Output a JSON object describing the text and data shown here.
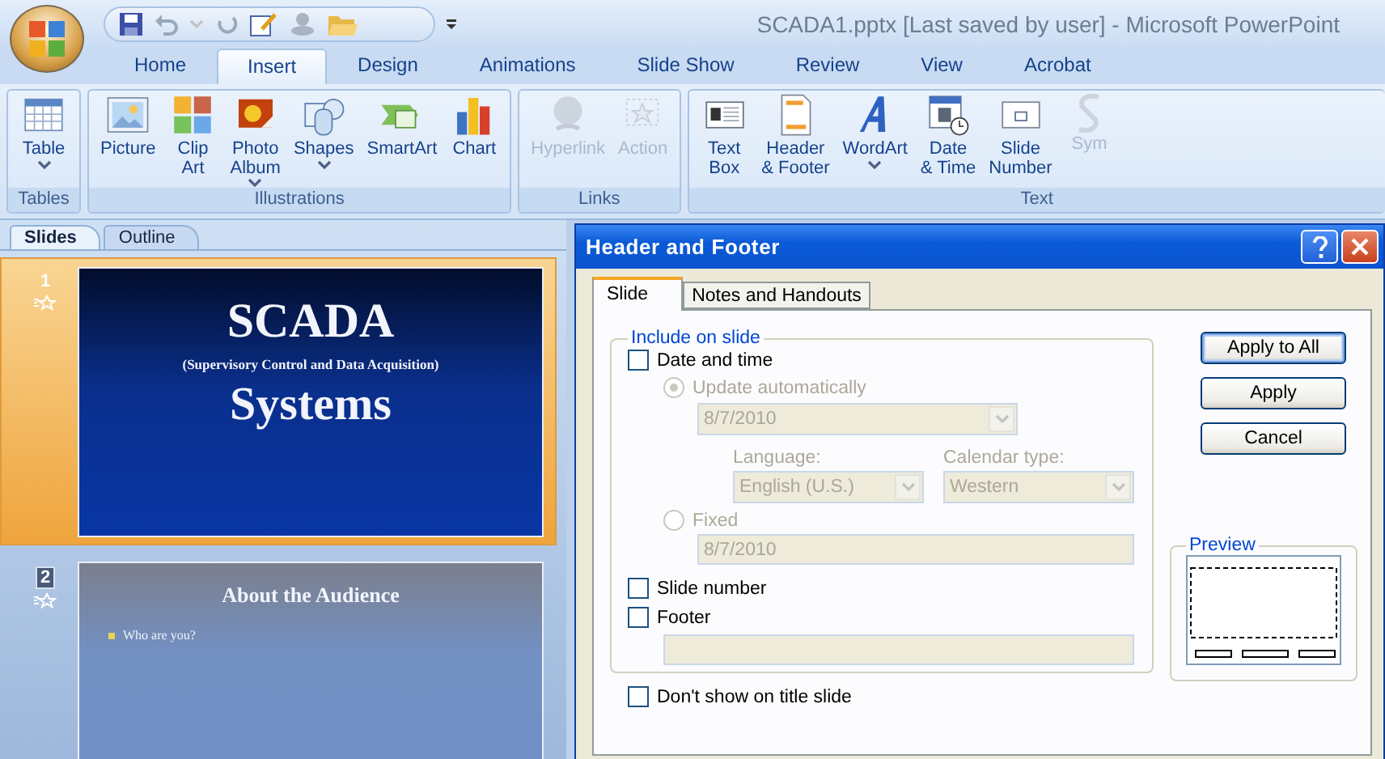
{
  "window": {
    "title": "SCADA1.pptx [Last saved by user] - Microsoft PowerPoint"
  },
  "ribbon_tabs": [
    {
      "label": "Home",
      "selected": false
    },
    {
      "label": "Insert",
      "selected": true
    },
    {
      "label": "Design",
      "selected": false
    },
    {
      "label": "Animations",
      "selected": false
    },
    {
      "label": "Slide Show",
      "selected": false
    },
    {
      "label": "Review",
      "selected": false
    },
    {
      "label": "View",
      "selected": false
    },
    {
      "label": "Acrobat",
      "selected": false
    }
  ],
  "ribbon_groups": [
    {
      "label": "Tables",
      "items": [
        {
          "label": "Table",
          "dropdown": true,
          "disabled": false
        }
      ]
    },
    {
      "label": "Illustrations",
      "items": [
        {
          "label": "Picture",
          "dropdown": false,
          "disabled": false
        },
        {
          "label": "Clip\nArt",
          "dropdown": false,
          "disabled": false
        },
        {
          "label": "Photo\nAlbum",
          "dropdown": true,
          "disabled": false
        },
        {
          "label": "Shapes",
          "dropdown": true,
          "disabled": false
        },
        {
          "label": "SmartArt",
          "dropdown": false,
          "disabled": false
        },
        {
          "label": "Chart",
          "dropdown": false,
          "disabled": false
        }
      ]
    },
    {
      "label": "Links",
      "items": [
        {
          "label": "Hyperlink",
          "dropdown": false,
          "disabled": true
        },
        {
          "label": "Action",
          "dropdown": false,
          "disabled": true
        }
      ]
    },
    {
      "label": "Text",
      "items": [
        {
          "label": "Text\nBox",
          "dropdown": false,
          "disabled": false
        },
        {
          "label": "Header\n& Footer",
          "dropdown": false,
          "disabled": false
        },
        {
          "label": "WordArt",
          "dropdown": true,
          "disabled": false
        },
        {
          "label": "Date\n& Time",
          "dropdown": false,
          "disabled": false
        },
        {
          "label": "Slide\nNumber",
          "dropdown": false,
          "disabled": false
        },
        {
          "label": "Sym",
          "dropdown": false,
          "disabled": true
        }
      ]
    }
  ],
  "panel_tabs": [
    {
      "label": "Slides",
      "selected": true
    },
    {
      "label": "Outline",
      "selected": false
    }
  ],
  "slides": [
    {
      "kind": "title",
      "number": "1",
      "selected": true,
      "title": "SCADA",
      "subtitle": "(Supervisory Control and Data Acquisition)",
      "title2": "Systems"
    },
    {
      "kind": "bullets",
      "number": "2",
      "selected": false,
      "title": "About the Audience",
      "bullets": [
        "Who are you?"
      ]
    }
  ],
  "dialog": {
    "title": "Header and Footer",
    "tabs": [
      {
        "label": "Slide",
        "selected": true
      },
      {
        "label": "Notes and Handouts",
        "selected": false
      }
    ],
    "section_label": "Include on slide",
    "date_time": {
      "label": "Date and time",
      "checked": false
    },
    "update_auto": {
      "label": "Update automatically",
      "selected": true,
      "disabled": true
    },
    "date_select": {
      "value": "8/7/2010",
      "disabled": true
    },
    "language": {
      "label": "Language:",
      "value": "English (U.S.)",
      "disabled": true
    },
    "calendar": {
      "label": "Calendar type:",
      "value": "Western",
      "disabled": true
    },
    "fixed": {
      "label": "Fixed",
      "selected": false,
      "disabled": true
    },
    "fixed_field": {
      "value": "8/7/2010",
      "disabled": true
    },
    "slide_number": {
      "label": "Slide number",
      "checked": false
    },
    "footer": {
      "label": "Footer",
      "checked": false
    },
    "footer_field": {
      "disabled": true
    },
    "dont_show": {
      "label": "Don't show on title slide",
      "checked": false
    },
    "buttons": [
      {
        "label": "Apply to All",
        "default": true
      },
      {
        "label": "Apply",
        "default": false
      },
      {
        "label": "Cancel",
        "default": false
      }
    ],
    "preview_label": "Preview"
  }
}
